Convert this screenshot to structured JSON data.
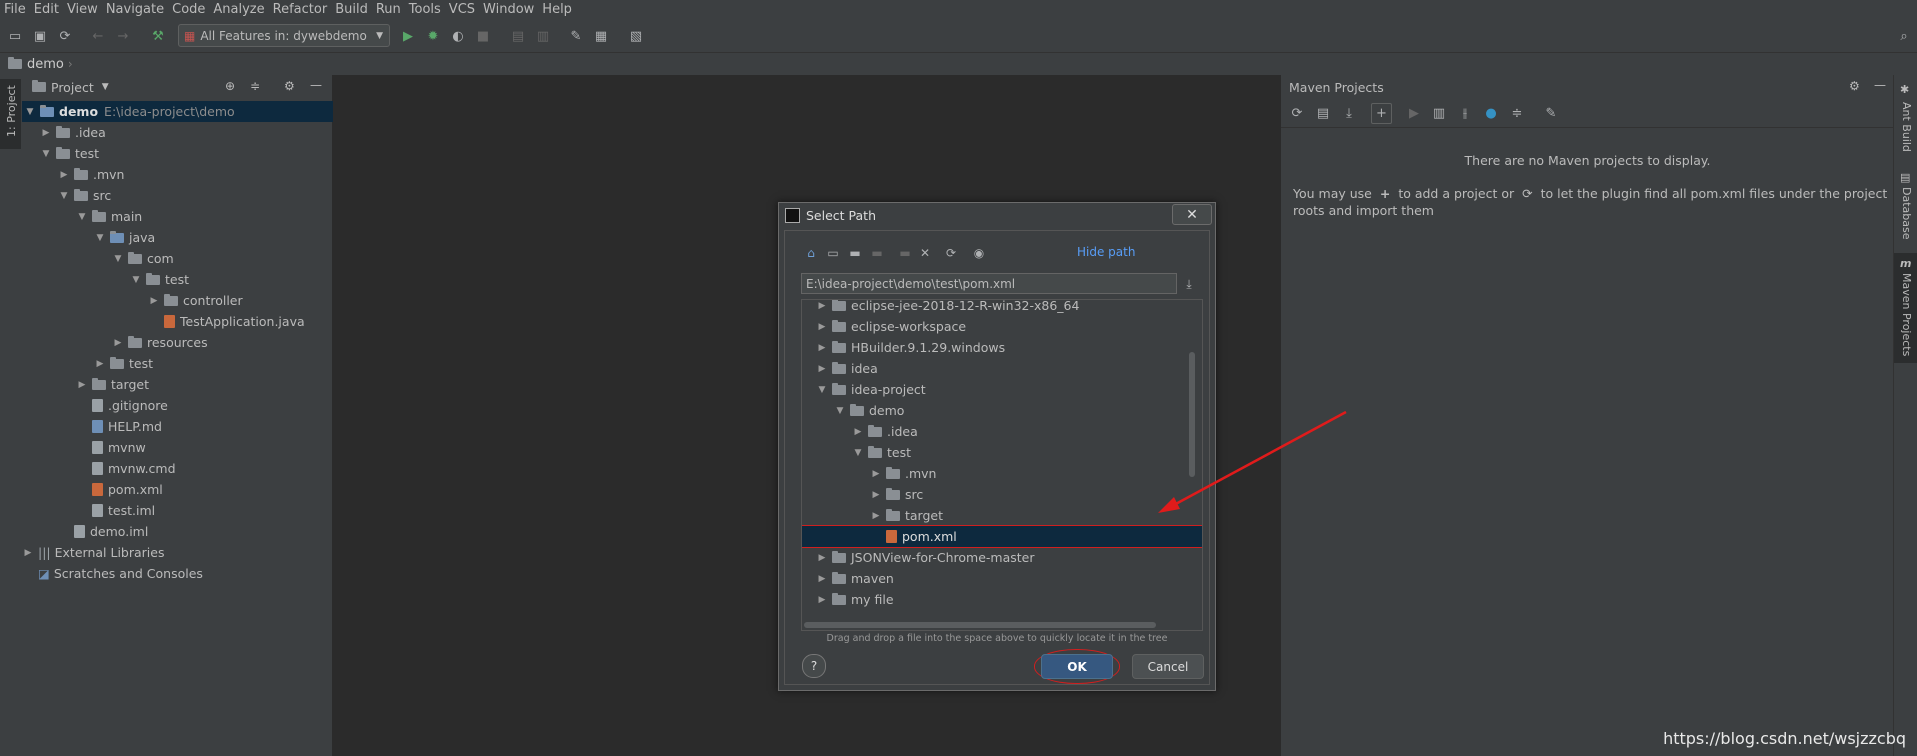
{
  "menu": [
    "File",
    "Edit",
    "View",
    "Navigate",
    "Code",
    "Analyze",
    "Refactor",
    "Build",
    "Run",
    "Tools",
    "VCS",
    "Window",
    "Help"
  ],
  "toolbar": {
    "run_config": "All Features in: dywebdemo"
  },
  "breadcrumb": "demo",
  "left_strip": {
    "project_tab": "1: Project"
  },
  "project_panel": {
    "title": "Project",
    "tree": [
      {
        "label": "demo",
        "extra": "E:\\idea-project\\demo"
      },
      {
        "label": ".idea"
      },
      {
        "label": "test"
      },
      {
        "label": ".mvn"
      },
      {
        "label": "src"
      },
      {
        "label": "main"
      },
      {
        "label": "java"
      },
      {
        "label": "com"
      },
      {
        "label": "test"
      },
      {
        "label": "controller"
      },
      {
        "label": "TestApplication.java"
      },
      {
        "label": "resources"
      },
      {
        "label": "test"
      },
      {
        "label": "target"
      },
      {
        "label": ".gitignore"
      },
      {
        "label": "HELP.md"
      },
      {
        "label": "mvnw"
      },
      {
        "label": "mvnw.cmd"
      },
      {
        "label": "pom.xml"
      },
      {
        "label": "test.iml"
      },
      {
        "label": "demo.iml"
      },
      {
        "label": "External Libraries"
      },
      {
        "label": "Scratches and Consoles"
      }
    ]
  },
  "maven": {
    "title": "Maven Projects",
    "empty": "There are no Maven projects to display.",
    "hint_a": "You may use",
    "hint_b": "to add a project or",
    "hint_c": "to let the plugin find all pom.xml files under the project roots",
    "hint_d": "and import them"
  },
  "right_strip": {
    "ant": "Ant Build",
    "database": "Database",
    "maven": "Maven Projects"
  },
  "dialog": {
    "title": "Select Path",
    "hide_path": "Hide path",
    "path": "E:\\idea-project\\demo\\test\\pom.xml",
    "tree": [
      {
        "label": "eclipse-jee-2018-12-R-win32-x86_64"
      },
      {
        "label": "eclipse-workspace"
      },
      {
        "label": "HBuilder.9.1.29.windows"
      },
      {
        "label": "idea"
      },
      {
        "label": "idea-project"
      },
      {
        "label": "demo"
      },
      {
        "label": ".idea"
      },
      {
        "label": "test"
      },
      {
        "label": ".mvn"
      },
      {
        "label": "src"
      },
      {
        "label": "target"
      },
      {
        "label": "pom.xml"
      },
      {
        "label": "JSONView-for-Chrome-master"
      },
      {
        "label": "maven"
      },
      {
        "label": "my file"
      }
    ],
    "drag_hint": "Drag and drop a file into the space above to quickly locate it in the tree",
    "help": "?",
    "ok": "OK",
    "cancel": "Cancel"
  },
  "watermark": "https://blog.csdn.net/wsjzzcbq",
  "colors": {
    "accent": "#365880",
    "selection": "#0d293e",
    "annotation": "#d01f1f"
  }
}
